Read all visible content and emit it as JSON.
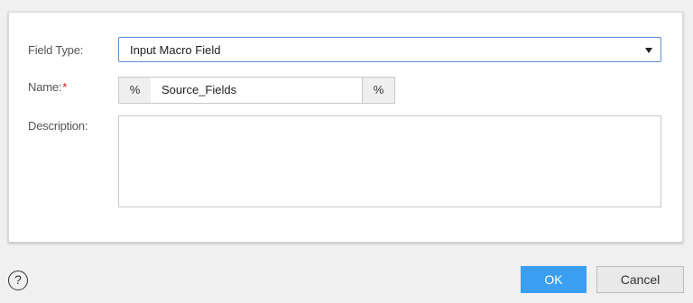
{
  "form": {
    "field_type_label": "Field Type:",
    "field_type_value": "Input Macro Field",
    "name_label": "Name:",
    "required_marker": "*",
    "name_prefix": "%",
    "name_value": "Source_Fields",
    "name_suffix": "%",
    "description_label": "Description:",
    "description_value": ""
  },
  "footer": {
    "help_glyph": "?",
    "ok_label": "OK",
    "cancel_label": "Cancel"
  },
  "colors": {
    "primary_button": "#3a9ff2",
    "required_star": "#d01a1a",
    "select_border": "#5b8fd6"
  },
  "icons": {
    "dropdown": "caret-down-icon",
    "help": "help-circle-icon"
  }
}
